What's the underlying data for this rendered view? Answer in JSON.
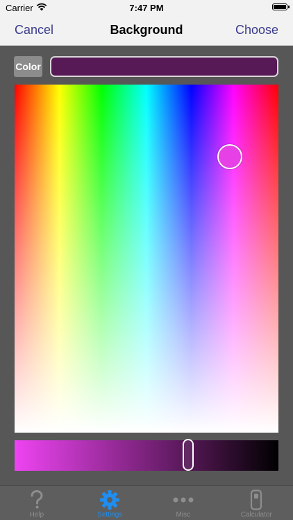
{
  "status_bar": {
    "carrier": "Carrier",
    "time": "7:47 PM"
  },
  "nav": {
    "left_label": "Cancel",
    "title": "Background",
    "right_label": "Choose"
  },
  "color_row": {
    "tag_label": "Color",
    "hex_value": ""
  },
  "selected_color": "#571a57",
  "accent_color": "#1e8ef0",
  "tab_bar": {
    "tabs": [
      {
        "label": "Help",
        "icon": "question-mark-icon",
        "active": false
      },
      {
        "label": "Settings",
        "icon": "gear-icon",
        "active": true
      },
      {
        "label": "Misc",
        "icon": "ellipsis-icon",
        "active": false
      },
      {
        "label": "Calculator",
        "icon": "calculator-icon",
        "active": false
      }
    ]
  }
}
